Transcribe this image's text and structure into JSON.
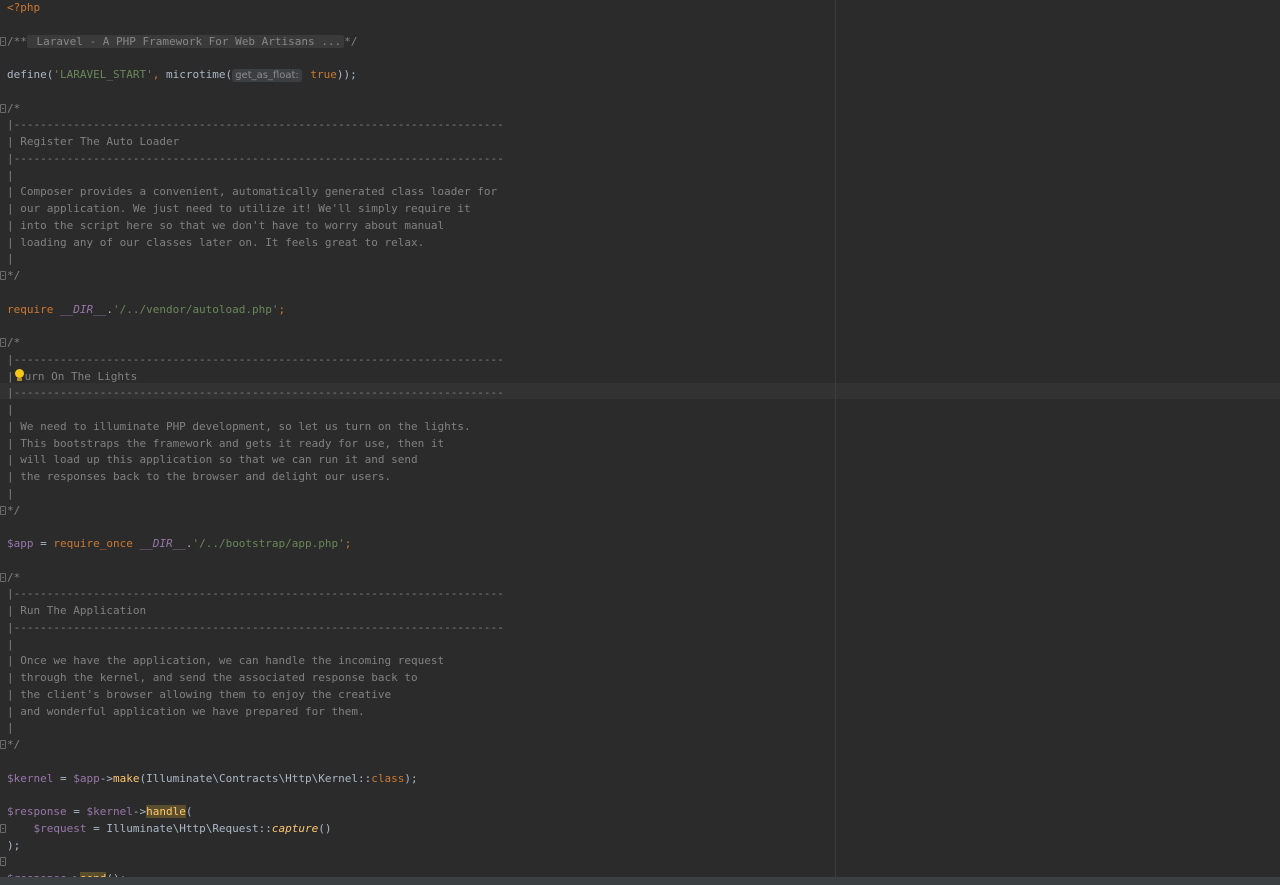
{
  "editor": {
    "lines": [
      [
        {
          "t": "<?php",
          "c": "tag"
        }
      ],
      [],
      [
        {
          "t": "/**",
          "c": "cmt"
        },
        {
          "t": " Laravel - A PHP Framework For Web Artisans ...",
          "c": "folded"
        },
        {
          "t": "*/",
          "c": "cmt"
        }
      ],
      [],
      [
        {
          "t": "define(",
          "c": ""
        },
        {
          "t": "'LARAVEL_START'",
          "c": "str"
        },
        {
          "t": ", ",
          "c": "kw"
        },
        {
          "t": "microtime(",
          "c": ""
        },
        {
          "t": "get_as_float:",
          "c": "hint"
        },
        {
          "t": " true",
          "c": "kw"
        },
        {
          "t": "));",
          "c": ""
        }
      ],
      [],
      [
        {
          "t": "/*",
          "c": "cmt"
        }
      ],
      [
        {
          "t": "|--------------------------------------------------------------------------",
          "c": "cmt"
        }
      ],
      [
        {
          "t": "| Register The Auto Loader",
          "c": "cmt"
        }
      ],
      [
        {
          "t": "|--------------------------------------------------------------------------",
          "c": "cmt"
        }
      ],
      [
        {
          "t": "|",
          "c": "cmt"
        }
      ],
      [
        {
          "t": "| Composer provides a convenient, automatically generated class loader for",
          "c": "cmt"
        }
      ],
      [
        {
          "t": "| our application. We just need to utilize it! We'll simply require it",
          "c": "cmt"
        }
      ],
      [
        {
          "t": "| into the script here so that we don't have to worry about manual",
          "c": "cmt"
        }
      ],
      [
        {
          "t": "| loading any of our classes later on. It feels great to relax.",
          "c": "cmt"
        }
      ],
      [
        {
          "t": "|",
          "c": "cmt"
        }
      ],
      [
        {
          "t": "*/",
          "c": "cmt"
        }
      ],
      [],
      [
        {
          "t": "require ",
          "c": "kw"
        },
        {
          "t": "__DIR__",
          "c": "const"
        },
        {
          "t": ".",
          "c": ""
        },
        {
          "t": "'/../vendor/autoload.php'",
          "c": "str"
        },
        {
          "t": ";",
          "c": "kw"
        }
      ],
      [],
      [
        {
          "t": "/*",
          "c": "cmt"
        }
      ],
      [
        {
          "t": "|--------------------------------------------------------------------------",
          "c": "cmt"
        }
      ],
      [
        {
          "t": "|",
          "c": "cmt"
        },
        {
          "t": "",
          "c": "bulb"
        },
        {
          "t": "urn On The Lights",
          "c": "cmt"
        }
      ],
      [
        {
          "t": "|--------------------------------------------------------------------------",
          "c": "cmt"
        }
      ],
      [
        {
          "t": "|",
          "c": "cmt"
        }
      ],
      [
        {
          "t": "| We need to illuminate PHP development, so let us turn on the lights.",
          "c": "cmt"
        }
      ],
      [
        {
          "t": "| This bootstraps the framework and gets it ready for use, then it",
          "c": "cmt"
        }
      ],
      [
        {
          "t": "| will load up this application so that we can run it and send",
          "c": "cmt"
        }
      ],
      [
        {
          "t": "| the responses back to the browser and delight our users.",
          "c": "cmt"
        }
      ],
      [
        {
          "t": "|",
          "c": "cmt"
        }
      ],
      [
        {
          "t": "*/",
          "c": "cmt"
        }
      ],
      [],
      [
        {
          "t": "$app",
          "c": "var"
        },
        {
          "t": " = ",
          "c": ""
        },
        {
          "t": "require_once ",
          "c": "kw"
        },
        {
          "t": "__DIR__",
          "c": "const"
        },
        {
          "t": ".",
          "c": ""
        },
        {
          "t": "'/../bootstrap/app.php'",
          "c": "str"
        },
        {
          "t": ";",
          "c": "kw"
        }
      ],
      [],
      [
        {
          "t": "/*",
          "c": "cmt"
        }
      ],
      [
        {
          "t": "|--------------------------------------------------------------------------",
          "c": "cmt"
        }
      ],
      [
        {
          "t": "| Run The Application",
          "c": "cmt"
        }
      ],
      [
        {
          "t": "|--------------------------------------------------------------------------",
          "c": "cmt"
        }
      ],
      [
        {
          "t": "|",
          "c": "cmt"
        }
      ],
      [
        {
          "t": "| Once we have the application, we can handle the incoming request",
          "c": "cmt"
        }
      ],
      [
        {
          "t": "| through the kernel, and send the associated response back to",
          "c": "cmt"
        }
      ],
      [
        {
          "t": "| the client's browser allowing them to enjoy the creative",
          "c": "cmt"
        }
      ],
      [
        {
          "t": "| and wonderful application we have prepared for them.",
          "c": "cmt"
        }
      ],
      [
        {
          "t": "|",
          "c": "cmt"
        }
      ],
      [
        {
          "t": "*/",
          "c": "cmt"
        }
      ],
      [],
      [
        {
          "t": "$kernel",
          "c": "var"
        },
        {
          "t": " = ",
          "c": ""
        },
        {
          "t": "$app",
          "c": "var"
        },
        {
          "t": "->",
          "c": ""
        },
        {
          "t": "make",
          "c": "fn"
        },
        {
          "t": "(Illuminate\\Contracts\\Http\\Kernel::",
          "c": ""
        },
        {
          "t": "class",
          "c": "kw"
        },
        {
          "t": ");",
          "c": ""
        }
      ],
      [],
      [
        {
          "t": "$response",
          "c": "var"
        },
        {
          "t": " = ",
          "c": ""
        },
        {
          "t": "$kernel",
          "c": "var"
        },
        {
          "t": "->",
          "c": ""
        },
        {
          "t": "handle",
          "c": "hl"
        },
        {
          "t": "(",
          "c": ""
        }
      ],
      [
        {
          "t": "    ",
          "c": ""
        },
        {
          "t": "$request",
          "c": "var"
        },
        {
          "t": " = Illuminate\\Http\\Request::",
          "c": ""
        },
        {
          "t": "capture",
          "c": "fn italic"
        },
        {
          "t": "()",
          "c": ""
        }
      ],
      [
        {
          "t": ");",
          "c": ""
        }
      ],
      [],
      [
        {
          "t": "$response",
          "c": "var"
        },
        {
          "t": "->",
          "c": ""
        },
        {
          "t": "send",
          "c": "hl"
        },
        {
          "t": "();",
          "c": ""
        }
      ]
    ],
    "fold_lines": [
      2,
      6,
      16,
      20,
      30,
      34,
      44,
      49,
      51
    ]
  }
}
